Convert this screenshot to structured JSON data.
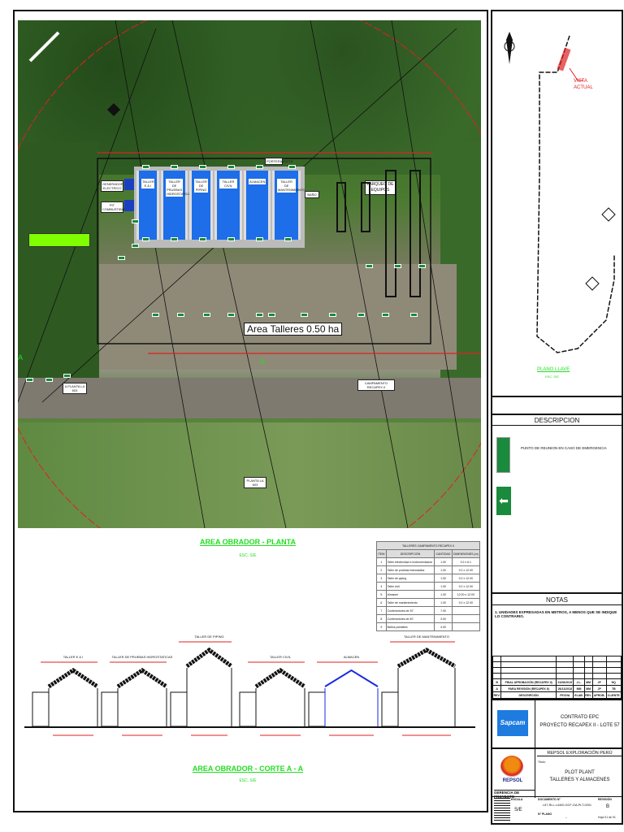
{
  "plan": {
    "title": "AREA OBRADOR - PLANTA",
    "scale": "ESC. S/E",
    "area_label": "Area Talleres 0.50 ha",
    "generator_label": "GENERADOR ELECTRICO",
    "fuel_label": "PIT COMBUSTIBLE",
    "parking_label": "PARQUEO DE EQUIPOS",
    "bath_label": "BAÑO",
    "guard_label": "PORTERIA/CCTV",
    "road_label_left": "A PLANTA LA 603",
    "road_label_right": "CAMPAMENTO RECAPEX II",
    "field_label": "PLANTA LA 603",
    "section_mark": "A",
    "shops": [
      "TALLER E & I",
      "TALLER DE PRUEBAS HIDROSTATICAS",
      "TALLER DE PIPING",
      "TALLER CIVIL",
      "ALMACEN",
      "TALLER DE MANTENIMIENTO"
    ]
  },
  "section": {
    "title": "AREA OBRADOR - CORTE A - A",
    "scale": "ESC. S/E",
    "buildings": [
      {
        "label": "TALLER E & I",
        "type": "truss"
      },
      {
        "label": "TALLER DE PRUEBAS HIDROSTATICAS",
        "type": "truss"
      },
      {
        "label": "TALLER DE PIPING",
        "type": "truss"
      },
      {
        "label": "TALLER CIVIL",
        "type": "truss"
      },
      {
        "label": "ALMACEN",
        "type": "blue"
      },
      {
        "label": "TALLER DE MANTENIMIENTO",
        "type": "truss"
      }
    ]
  },
  "table": {
    "title": "TALLERES CAMPAMENTO RECAPEX II",
    "headers": [
      "ITEM",
      "DESCRIPCIÓN",
      "CANTIDAD",
      "DIMENSIONES (m)"
    ],
    "rows": [
      [
        "1",
        "Taller electricidad e instrumentacion",
        "1.00",
        "9.2 x 6.1"
      ],
      [
        "2",
        "Taller de pruebas hidrostatica",
        "1.00",
        "9.2 x 12.00"
      ],
      [
        "3",
        "Taller de piping",
        "1.00",
        "9.2 x 12.00"
      ],
      [
        "4",
        "Taller civil",
        "1.00",
        "9.2 x 12.00"
      ],
      [
        "5",
        "Almacen",
        "1.00",
        "12.00 x 12.00"
      ],
      [
        "6",
        "Taller de mantenimiento",
        "1.00",
        "9.2 x 12.00"
      ],
      [
        "7",
        "Contenedores de 20'",
        "7.00",
        ""
      ],
      [
        "8",
        "Contenedores de 40'",
        "3.00",
        ""
      ],
      [
        "9",
        "Baños portatiles",
        "4.00",
        ""
      ]
    ]
  },
  "keymap": {
    "title": "PLANO LLAVE",
    "scale": "ESC. S/E",
    "current_view": "VISTA ACTUAL"
  },
  "description": {
    "title": "DESCRIPCION",
    "items": [
      {
        "icon": "assembly-point-icon",
        "text": "PUNTO DE REUNION EN CASO DE EMERGENCIA"
      },
      {
        "icon": "exit-arrow-icon",
        "text": ""
      }
    ]
  },
  "notes": {
    "title": "NOTAS",
    "items": [
      "1. UNIDADES EXPRESADAS EN METROS, A MENOS QUE SE INDIQUE LO CONTRARIO."
    ]
  },
  "revisions": {
    "rows": [
      [
        "B",
        "FINAL APROBACIÓN (RECAPEX II)",
        "01/06/2019",
        "J.L.",
        "MM",
        "JP",
        "HQ"
      ],
      [
        "A",
        "PARA REVISIÓN (RECAPEX II)",
        "26/11/2018",
        "MM",
        "MM",
        "JP",
        "TB"
      ]
    ],
    "headers": [
      "REV.",
      "DESCRIPCIÓN",
      "FECHA",
      "ELAB.",
      "REV.",
      "APROB.",
      "CLIENTE"
    ]
  },
  "title_block": {
    "contractor": "Sapcam",
    "contract": "CONTRATO EPC",
    "project": "PROYECTO RECAPEX II - LOTE 57",
    "client": "REPSOL EXPLORACIÓN PERÚ",
    "client_logo": "REPSOL",
    "title_label": "Título:",
    "drawing_title": "PLOT PLANT",
    "drawing_subtitle": "TALLERES Y ALMACENES",
    "project_manager": "GERENCIA DE PROYECTO",
    "scale_label": "ESCALA",
    "scale": "S/E",
    "doc_label": "DOCUMENTO N°",
    "doc_number": "L57-RLL-L4400-GCF-GA-PLT-0001",
    "rev_label": "REVISIÓN",
    "rev": "B",
    "page_label": "Hoja 01 de 01",
    "plan_label": "N° PLANO",
    "plan": "-"
  }
}
